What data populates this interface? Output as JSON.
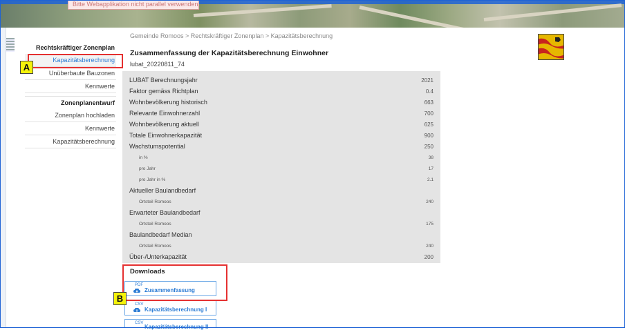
{
  "banner": {
    "alert_text": "Bitte Webapplikation nicht parallel verwenden"
  },
  "sidebar": {
    "items": [
      {
        "label": "Rechtskräftiger Zonenplan",
        "kind": "head"
      },
      {
        "label": "Kapazitätsberechnung",
        "kind": "active"
      },
      {
        "label": "Unüberbaute Bauzonen",
        "kind": "item"
      },
      {
        "label": "Kennwerte",
        "kind": "item"
      },
      {
        "label": "Zonenplanentwurf",
        "kind": "head"
      },
      {
        "label": "Zonenplan hochladen",
        "kind": "item"
      },
      {
        "label": "Kennwerte",
        "kind": "item"
      },
      {
        "label": "Kapazitätsberechnung",
        "kind": "item"
      }
    ]
  },
  "breadcrumb": "Gemeinde Romoos > Rechtskräftiger Zonenplan > Kapazitätsberechnung",
  "main": {
    "title": "Zusammenfassung der Kapazitätsberechnung Einwohner",
    "id": "lubat_20220811_74"
  },
  "rows": [
    {
      "label": "LUBAT Berechnungsjahr",
      "value": "2021",
      "sub": false
    },
    {
      "label": "Faktor gemäss Richtplan",
      "value": "0.4",
      "sub": false
    },
    {
      "label": "Wohnbevölkerung historisch",
      "value": "663",
      "sub": false
    },
    {
      "label": "Relevante Einwohnerzahl",
      "value": "700",
      "sub": false
    },
    {
      "label": "Wohnbevölkerung aktuell",
      "value": "625",
      "sub": false
    },
    {
      "label": "Totale Einwohnerkapazität",
      "value": "900",
      "sub": false
    },
    {
      "label": "Wachstumspotential",
      "value": "250",
      "sub": false
    },
    {
      "label": "in %",
      "value": "38",
      "sub": true
    },
    {
      "label": "pro Jahr",
      "value": "17",
      "sub": true
    },
    {
      "label": "pro Jahr in %",
      "value": "2.1",
      "sub": true
    },
    {
      "label": "Aktueller Baulandbedarf",
      "value": "",
      "sub": false
    },
    {
      "label": "Ortsteil Romoos",
      "value": "240",
      "sub": true
    },
    {
      "label": "Erwarteter Baulandbedarf",
      "value": "",
      "sub": false
    },
    {
      "label": "Ortsteil Romoos",
      "value": "175",
      "sub": true
    },
    {
      "label": "Baulandbedarf Median",
      "value": "",
      "sub": false
    },
    {
      "label": "Ortsteil Romoos",
      "value": "240",
      "sub": true
    },
    {
      "label": "Über-/Unterkapazität",
      "value": "200",
      "sub": false
    }
  ],
  "downloads": {
    "heading": "Downloads",
    "buttons": [
      {
        "type": "PDF",
        "label": "Zusammenfassung"
      },
      {
        "type": "CSV",
        "label": "Kapazitätsberechnung I"
      },
      {
        "type": "CSV",
        "label": "Kapazitätsberechnung II"
      }
    ]
  },
  "annotations": {
    "a": "A",
    "b": "B"
  },
  "colors": {
    "accent": "#2a7bd4",
    "annotation_red": "#e53030",
    "annotation_yellow": "#f5f30a",
    "table_bg": "#e4e4e4"
  }
}
